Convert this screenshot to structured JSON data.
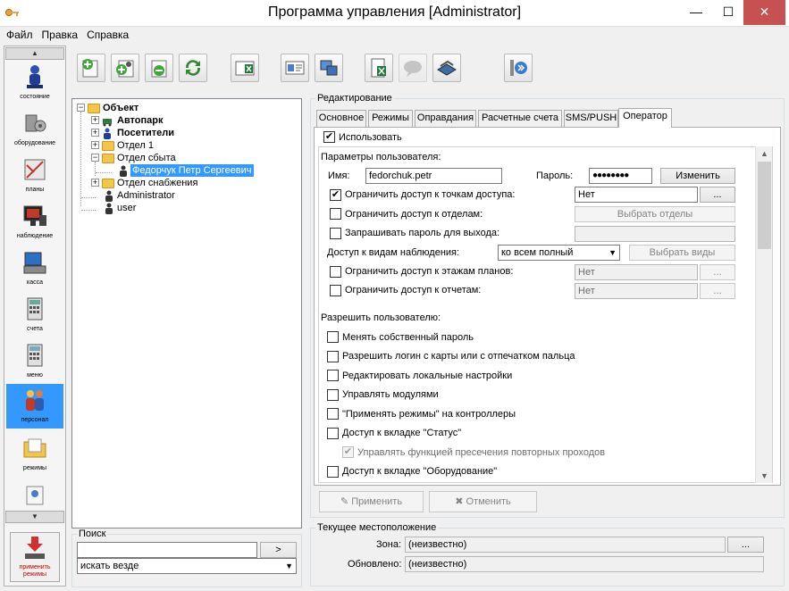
{
  "window": {
    "title": "Программа управления [Administrator]",
    "min_label": "—",
    "max_label": "☐",
    "close_label": "✕"
  },
  "menu": [
    "Файл",
    "Правка",
    "Справка"
  ],
  "rail": {
    "items": [
      {
        "label": "состояние",
        "icon": "status-icon"
      },
      {
        "label": "оборудование",
        "icon": "equipment-icon"
      },
      {
        "label": "планы",
        "icon": "plans-icon"
      },
      {
        "label": "наблюдение",
        "icon": "monitoring-icon"
      },
      {
        "label": "касса",
        "icon": "cash-register-icon"
      },
      {
        "label": "счета",
        "icon": "accounts-icon"
      },
      {
        "label": "меню",
        "icon": "menu-icon"
      },
      {
        "label": "персонал",
        "icon": "personnel-icon",
        "selected": true
      },
      {
        "label": "режимы",
        "icon": "modes-icon"
      },
      {
        "label": "",
        "icon": "badge-icon"
      }
    ],
    "apply_label_1": "применить",
    "apply_label_2": "режимы"
  },
  "tree": {
    "root": "Объект",
    "nodes": {
      "autopark": "Автопарк",
      "visitors": "Посетители",
      "dept1": "Отдел 1",
      "sales": "Отдел сбыта",
      "employee": "Федорчук Петр Сергеевич",
      "supply": "Отдел снабжения",
      "admin": "Administrator",
      "user": "user"
    }
  },
  "search": {
    "group_label": "Поиск",
    "value": "",
    "go_label": ">",
    "scope": "искать везде"
  },
  "edit": {
    "group_label": "Редактирование",
    "tabs": [
      "Основное",
      "Режимы",
      "Оправдания",
      "Расчетные счета",
      "SMS/PUSH",
      "Оператор"
    ],
    "active_tab": "Оператор",
    "use_label": "Использовать",
    "params_label": "Параметры пользователя:",
    "name_label": "Имя:",
    "name_value": "fedorchuk.petr",
    "password_label": "Пароль:",
    "password_value": "●●●●●●●●",
    "change_label": "Изменить",
    "access_points_label": "Ограничить доступ к точкам доступа:",
    "access_points_value": "Нет",
    "ellipsis": "...",
    "departments_label": "Ограничить доступ к отделам:",
    "select_departments_label": "Выбрать отделы",
    "exit_password_label": "Запрашивать пароль для выхода:",
    "views_label": "Доступ к видам наблюдения:",
    "views_value": "ко всем полный",
    "select_views_label": "Выбрать виды",
    "floors_label": "Ограничить доступ к этажам планов:",
    "floors_value": "Нет",
    "reports_label": "Ограничить доступ к отчетам:",
    "reports_value": "Нет",
    "allow_label": "Разрешить пользователю:",
    "permissions": [
      "Менять собственный пароль",
      "Разрешить логин с карты или с отпечатком пальца",
      "Редактировать локальные настройки",
      "Управлять модулями",
      "\"Применять режимы\" на контроллеры",
      "Доступ к вкладке \"Статус\""
    ],
    "sub_permission": "Управлять функцией пресечения повторных проходов",
    "last_permission": "Доступ к вкладке \"Оборудование\"",
    "apply_label": "Применить",
    "cancel_label": "Отменить"
  },
  "location": {
    "group_label": "Текущее местоположение",
    "zone_label": "Зона:",
    "zone_value": "(неизвестно)",
    "updated_label": "Обновлено:",
    "updated_value": "(неизвестно)",
    "ellipsis": "..."
  }
}
